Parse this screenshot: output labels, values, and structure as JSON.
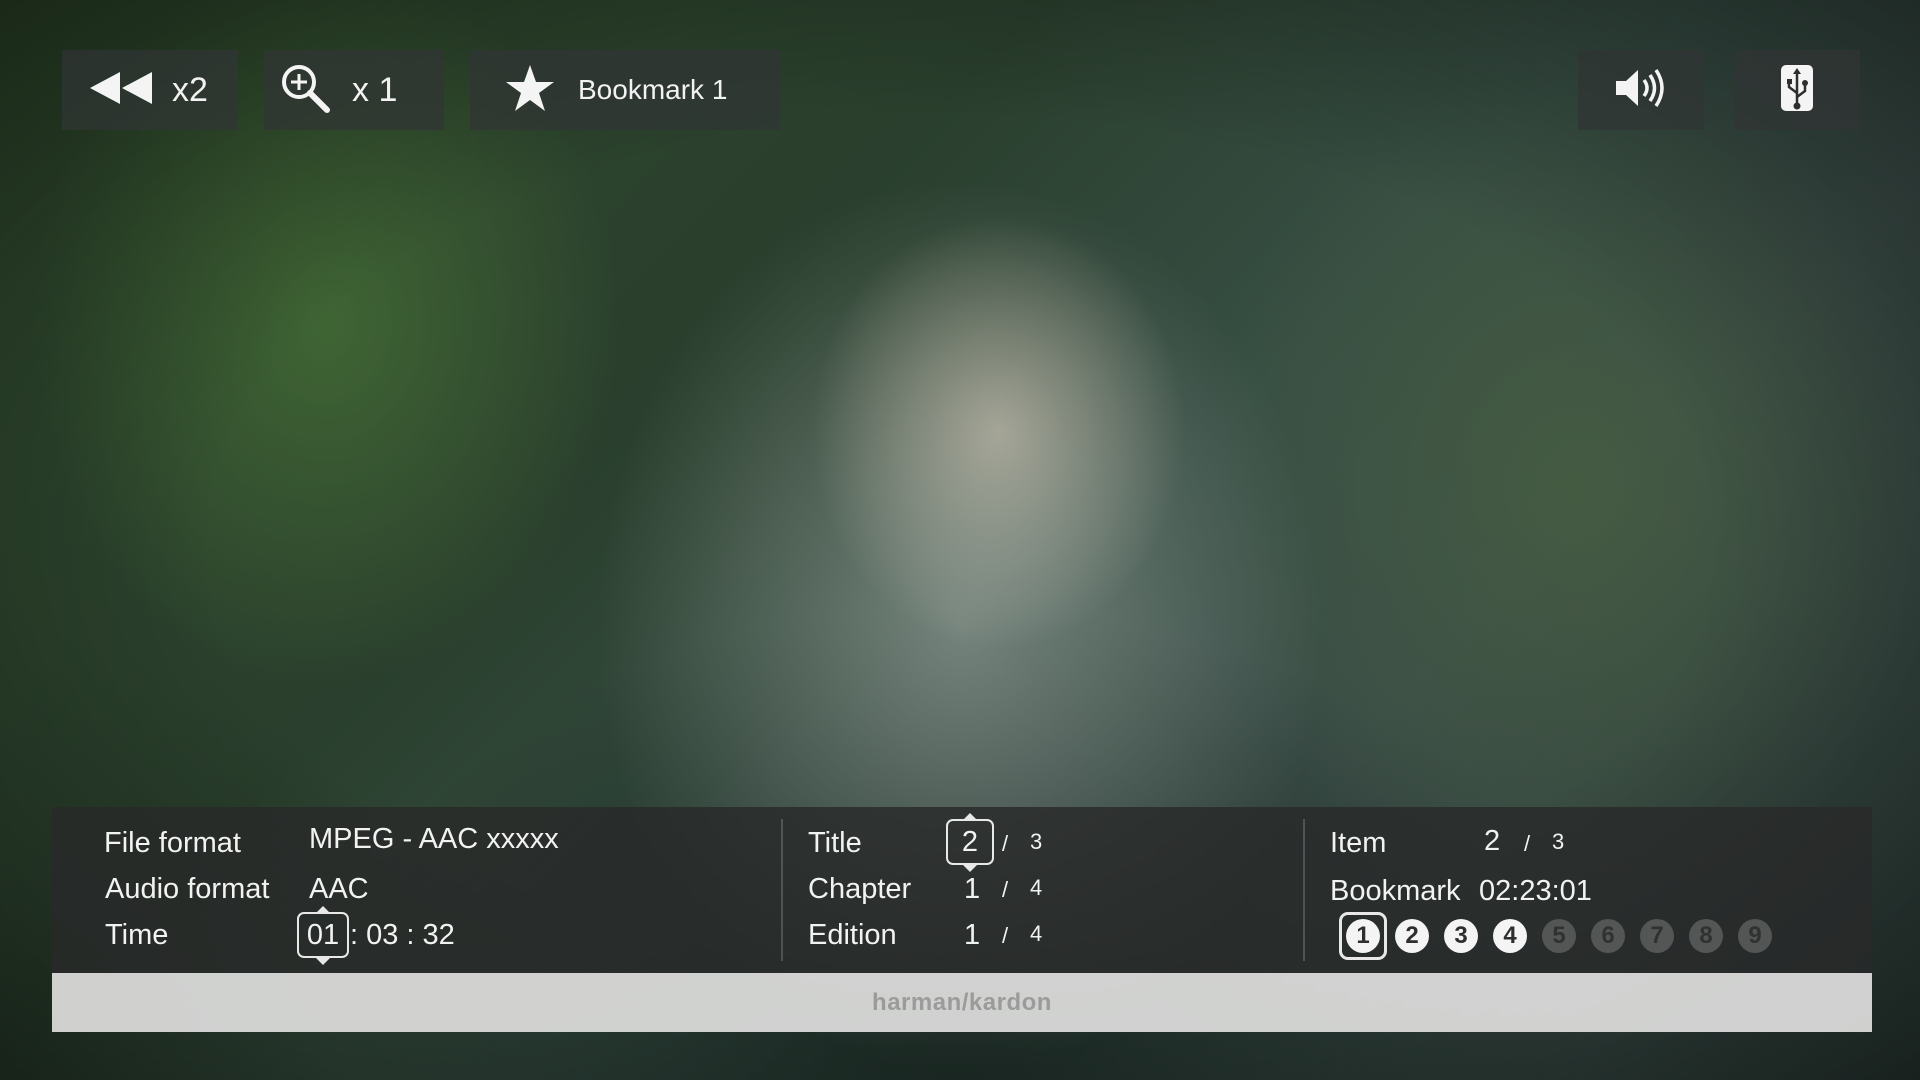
{
  "top_bar": {
    "rewind": {
      "icon": "rewind-icon",
      "label": "x2"
    },
    "zoom": {
      "icon": "zoom-in-icon",
      "label": "x 1"
    },
    "bookmark": {
      "icon": "star-icon",
      "label": "Bookmark 1"
    },
    "volume": {
      "icon": "speaker-volume-icon"
    },
    "usb": {
      "icon": "usb-icon"
    }
  },
  "info_panel": {
    "file_format": {
      "label": "File format",
      "value": "MPEG - AAC xxxxx"
    },
    "audio_format": {
      "label": "Audio format",
      "value": "AAC"
    },
    "time": {
      "label": "Time",
      "hours": "01",
      "rest": ": 03 : 32"
    },
    "title": {
      "label": "Title",
      "current": "2",
      "separator": "/",
      "total": "3"
    },
    "chapter": {
      "label": "Chapter",
      "current": "1",
      "separator": "/",
      "total": "4"
    },
    "edition": {
      "label": "Edition",
      "current": "1",
      "separator": "/",
      "total": "4"
    },
    "item": {
      "label": "Item",
      "current": "2",
      "separator": "/",
      "total": "3"
    },
    "bookmark": {
      "label": "Bookmark",
      "time": "02:23:01",
      "slots": [
        "1",
        "2",
        "3",
        "4",
        "5",
        "6",
        "7",
        "8",
        "9"
      ],
      "active_slots": 4,
      "selected_slot": 1
    }
  },
  "brand": {
    "text": "harman/kardon"
  },
  "colors": {
    "panel": "#2a2c2c",
    "brand_bar": "#e0e0de",
    "text": "#f2f2f2"
  }
}
